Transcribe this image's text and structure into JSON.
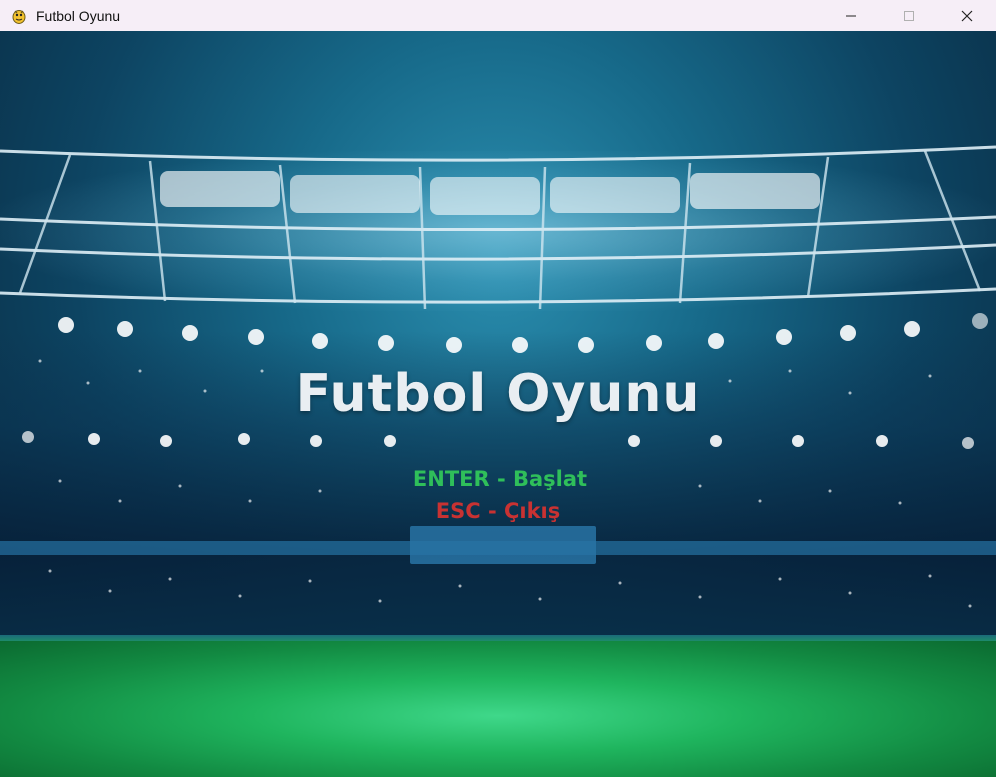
{
  "window": {
    "title": "Futbol Oyunu",
    "controls": [
      "minimize",
      "maximize",
      "close"
    ]
  },
  "game": {
    "title": "Futbol Oyunu",
    "menu": {
      "start_label": "ENTER - Başlat",
      "exit_label": "ESC - Çıkış"
    }
  },
  "colors": {
    "title_text": "#e9eef2",
    "start_text": "#2fbf5a",
    "exit_text": "#c83232",
    "pitch": "#1fb55e",
    "sky": "#176a8a"
  },
  "icons": {
    "app": "pygame-snake-icon",
    "minimize": "minimize-icon",
    "maximize": "maximize-icon",
    "close": "close-icon"
  }
}
